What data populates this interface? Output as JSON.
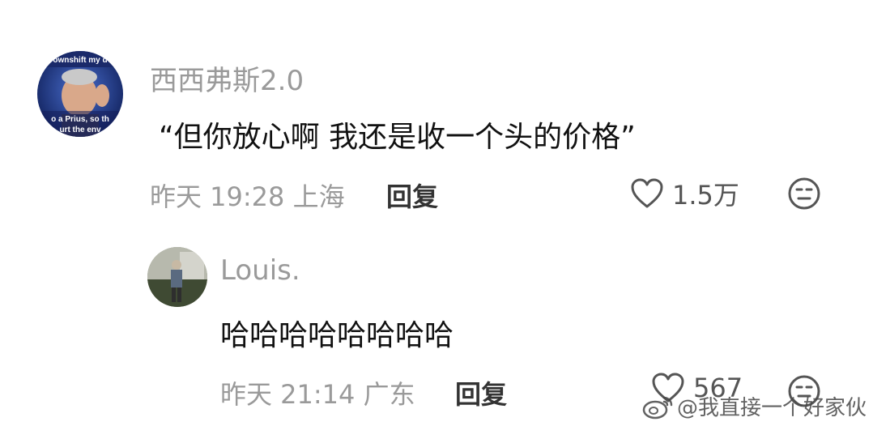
{
  "comments": [
    {
      "username": "西西弗斯2.0",
      "avatar_caption_top": "ownshift my d",
      "avatar_caption_bottom1": "o a Prius, so th",
      "avatar_caption_bottom2": "urt the env",
      "text": "“但你放心啊 我还是收一个头的价格”",
      "time": "昨天 19:28",
      "location": "上海",
      "reply_label": "回复",
      "likes": "1.5万"
    },
    {
      "username": "Louis.",
      "text": "哈哈哈哈哈哈哈哈",
      "time": "昨天 21:14",
      "location": "广东",
      "reply_label": "回复",
      "likes": "567"
    }
  ],
  "watermark": {
    "text": "@我直接一个好家伙",
    "icon": "weibo-icon"
  },
  "colors": {
    "meta_gray": "#9a9a9a",
    "text": "#111111",
    "icon_gray": "#555555"
  }
}
